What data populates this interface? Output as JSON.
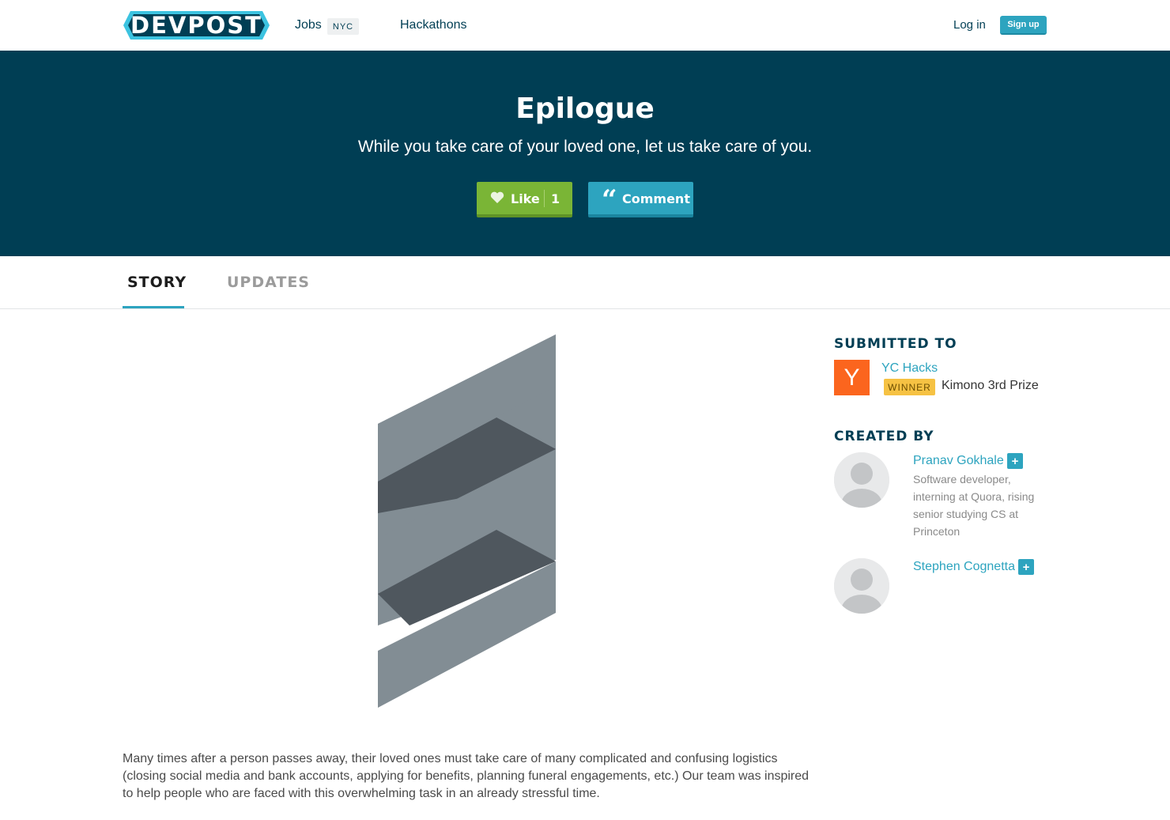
{
  "nav": {
    "logo_text": "DEVPOST",
    "jobs_label": "Jobs",
    "jobs_badge": "NYC",
    "hackathons_label": "Hackathons",
    "login_label": "Log in",
    "signup_label": "Sign up"
  },
  "hero": {
    "title": "Epilogue",
    "tagline": "While you take care of your loved one, let us take care of you.",
    "like_label": "Like",
    "like_count": "1",
    "comment_label": "Comment"
  },
  "tabs": [
    {
      "label": "STORY",
      "active": true
    },
    {
      "label": "UPDATES",
      "active": false
    }
  ],
  "story": {
    "description": "Many times after a person passes away, their loved ones must take care of many complicated and confusing logistics (closing social media and bank accounts, applying for benefits, planning funeral engagements, etc.) Our team was inspired to help people who are faced with this overwhelming task in an already stressful time."
  },
  "sidebar": {
    "submitted_heading": "SUBMITTED TO",
    "hackathon": {
      "logo_letter": "Y",
      "name": "YC Hacks",
      "badge": "WINNER",
      "prize": "Kimono 3rd Prize"
    },
    "created_heading": "CREATED BY",
    "members": [
      {
        "name": "Pranav Gokhale",
        "bio": "Software developer, interning at Quora, rising senior studying CS at Princeton",
        "action": "+"
      },
      {
        "name": "Stephen Cognetta",
        "bio": "",
        "action": "+"
      }
    ]
  },
  "colors": {
    "brand_dark": "#003e54",
    "accent": "#2da4bf",
    "like_green": "#7ab536",
    "winner_yellow": "#f6c243",
    "yc_orange": "#fb651e"
  },
  "icons": [
    "heart-icon",
    "quote-icon",
    "devpost-logo",
    "avatar-placeholder"
  ]
}
